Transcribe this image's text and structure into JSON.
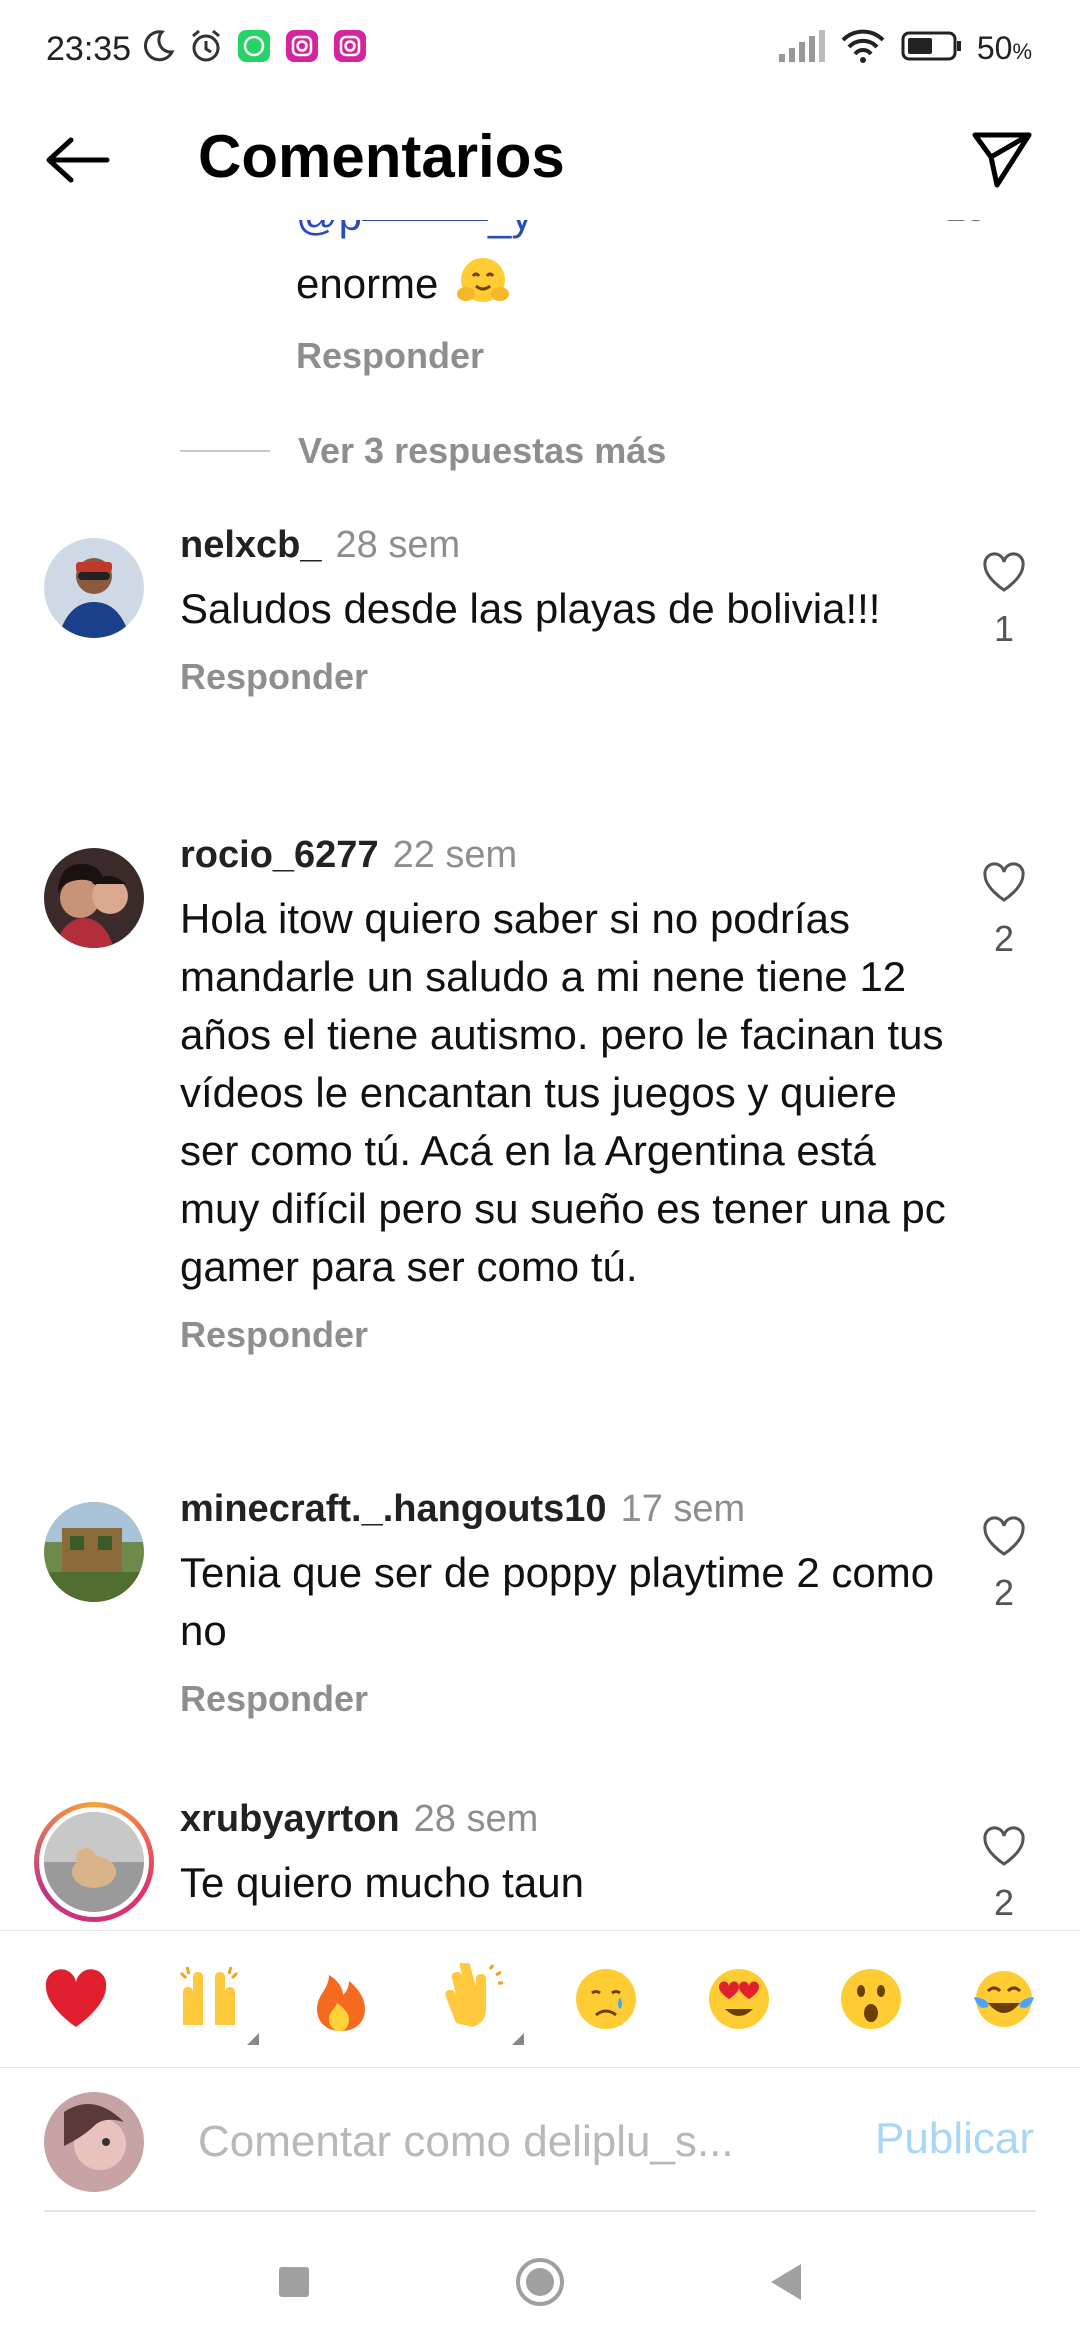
{
  "status_bar": {
    "time": "23:35",
    "battery": "50",
    "battery_unit": "%",
    "icons": [
      "moon-icon",
      "alarm-icon",
      "whatsapp-icon",
      "instagram-icon",
      "instagram-icon",
      "signal-icon",
      "wifi-icon",
      "battery-icon"
    ]
  },
  "header": {
    "title": "Comentarios",
    "back_icon": "arrow-left-icon",
    "share_icon": "send-icon"
  },
  "partial_comment": {
    "text_prefix": "enorme",
    "emoji": "hugging-face",
    "reply_label": "Responder"
  },
  "view_replies": {
    "label": "Ver 3 respuestas más"
  },
  "comments": [
    {
      "username": "nelxcb_",
      "time": "28 sem",
      "text": "Saludos desde las playas de bolivia!!!",
      "likes": "1",
      "reply_label": "Responder"
    },
    {
      "username": "rocio_6277",
      "time": "22 sem",
      "text": "Hola itow quiero saber si no podrías mandarle un saludo a mi nene tiene 12 años el tiene autismo. pero le facinan tus vídeos le encantan tus juegos y quiere ser como tú. Acá en la Argentina está muy difícil pero su sueño es tener una pc gamer para ser como tú.",
      "likes": "2",
      "reply_label": "Responder"
    },
    {
      "username": "minecraft._.hangouts10",
      "time": "17 sem",
      "text": "Tenia que ser de poppy playtime 2 como no",
      "likes": "2",
      "reply_label": "Responder"
    },
    {
      "username": "xrubyayrton",
      "time": "28 sem",
      "text": "Te quiero mucho taun",
      "likes": "2"
    }
  ],
  "emoji_bar": [
    "red-heart",
    "raising-hands",
    "fire",
    "clapping-hands",
    "crying-face",
    "heart-eyes",
    "astonished-face",
    "tears-of-joy"
  ],
  "composer": {
    "placeholder": "Comentar como deliplu_s...",
    "publish_label": "Publicar"
  },
  "nav": [
    "recents-icon",
    "home-icon",
    "back-icon"
  ]
}
